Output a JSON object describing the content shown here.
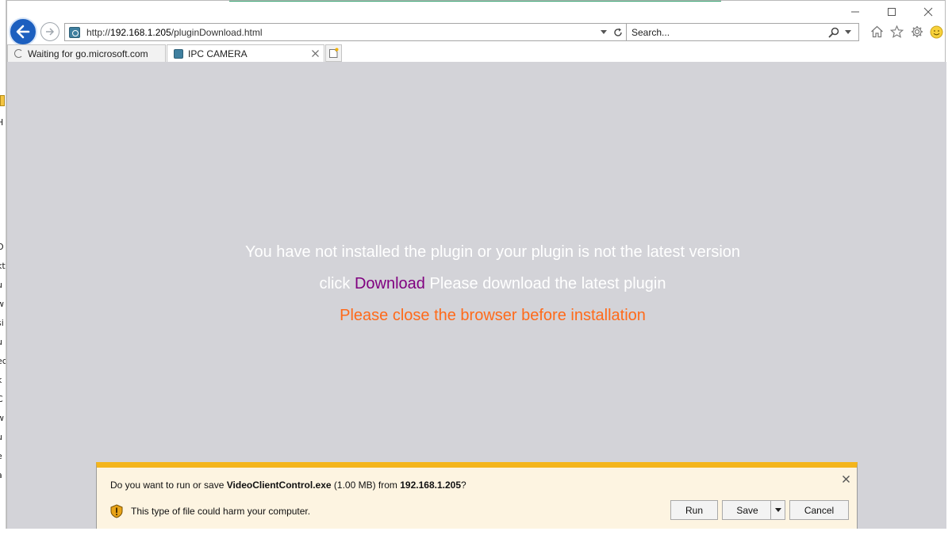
{
  "background_window": {
    "fragments": [
      "H",
      "O",
      "kt",
      "u",
      "w",
      "si",
      "u",
      "ec",
      "k",
      "C",
      "w",
      "u",
      "e",
      "a"
    ]
  },
  "window_controls": {
    "minimize": "─",
    "maximize": "☐",
    "close": "✕"
  },
  "address_bar": {
    "prefix": "http://",
    "host": "192.168.1.205",
    "path": "/pluginDownload.html"
  },
  "search_bar": {
    "placeholder": "Search..."
  },
  "tabs": [
    {
      "label": "Waiting for go.microsoft.com",
      "state": "loading"
    },
    {
      "label": "IPC CAMERA",
      "state": "active"
    }
  ],
  "page": {
    "line1": "You have not installed the plugin or your plugin is not the latest version",
    "line2_prefix": "click ",
    "line2_link": "Download",
    "line2_suffix": " Please download the latest plugin",
    "line3": "Please close the browser before installation",
    "colors": {
      "background": "#d3d3d8",
      "message": "#ffffff",
      "link": "#800080",
      "warning": "#ff6a1a"
    }
  },
  "notification": {
    "q_prefix": "Do you want to run or save ",
    "file_name": "VideoClientControl.exe",
    "file_size": " (1.00 MB) from ",
    "source": "192.168.1.205",
    "q_suffix": "?",
    "warning": "This type of file could harm your computer.",
    "run_label": "Run",
    "save_label": "Save",
    "cancel_label": "Cancel",
    "accent_color": "#f4b51c"
  }
}
